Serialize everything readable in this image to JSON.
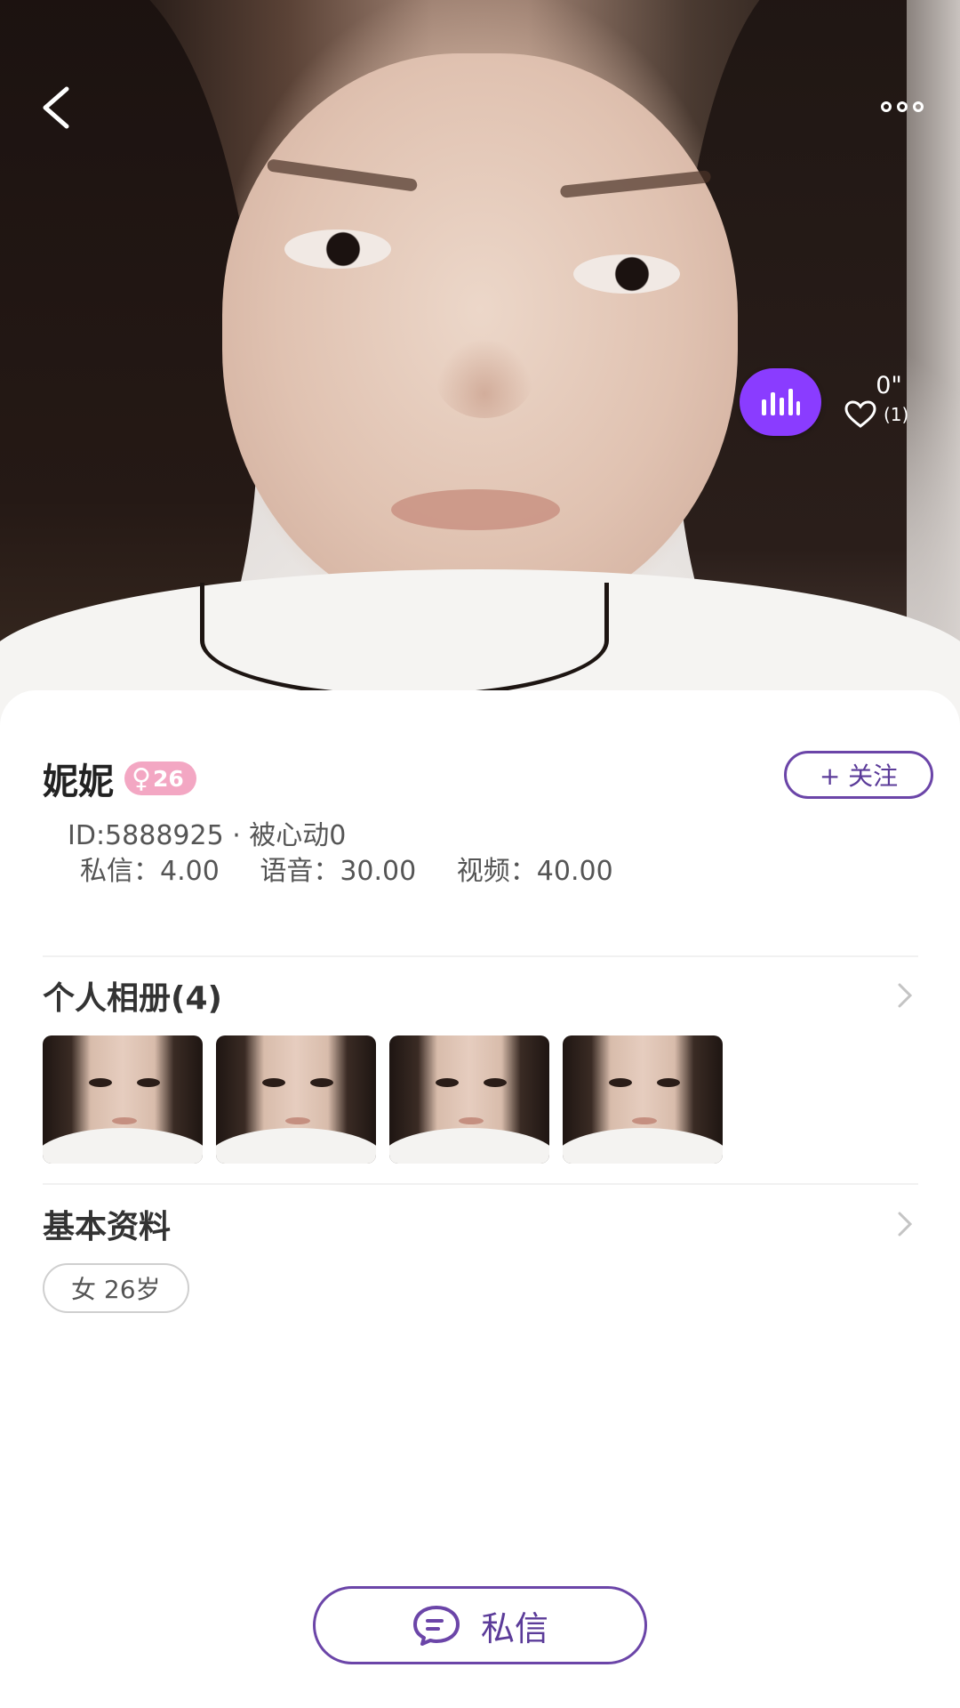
{
  "header": {
    "voice_duration": "0\"",
    "like_count": "(1)"
  },
  "profile": {
    "name": "妮妮",
    "gender_symbol": "♀",
    "age_badge": "26",
    "follow_label": "+ 关注",
    "id_line": "ID:5888925 · 被心动0",
    "prices": {
      "message": "私信：4.00",
      "voice": "语音：30.00",
      "video": "视频：40.00"
    }
  },
  "album": {
    "title": "个人相册(4)",
    "photo_count": 4
  },
  "basic_info": {
    "title": "基本资料",
    "tag": "女 26岁"
  },
  "footer": {
    "message_label": "私信"
  },
  "colors": {
    "accent_purple": "#8a3cff",
    "button_border": "#6b45a8",
    "gender_pink": "#f3a7c3"
  },
  "icons": [
    "back-arrow-icon",
    "more-dots-icon",
    "voice-bars-icon",
    "heart-icon",
    "chevron-right-icon",
    "chat-bubble-icon"
  ]
}
